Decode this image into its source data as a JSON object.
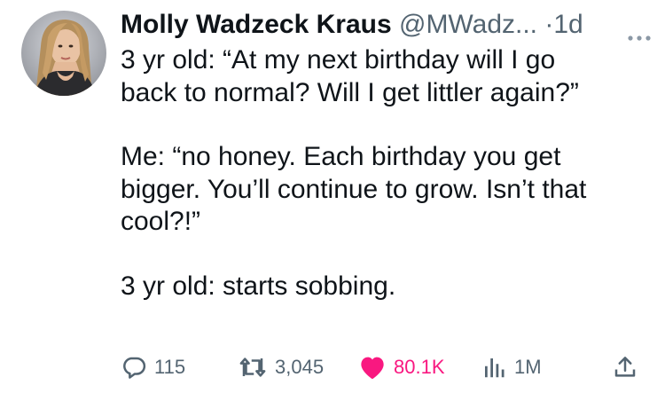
{
  "tweet": {
    "author_name": "Molly Wadzeck Kraus",
    "author_handle": "@MWadz...",
    "separator": "·",
    "timestamp": "1d",
    "lines": [
      "3 yr old: “At my next birthday will I go",
      "back to normal? Will I get littler again?”",
      "",
      "Me: “no honey. Each birthday you get",
      "bigger. You’ll continue to grow. Isn’t that",
      "cool?!”",
      "",
      "3 yr old: starts sobbing."
    ]
  },
  "actions": {
    "replies": "115",
    "retweets": "3,045",
    "likes": "80.1K",
    "views": "1M"
  },
  "icons": {
    "reply": "speech-bubble-icon",
    "retweet": "retweet-arrows-icon",
    "like": "heart-icon",
    "views": "bar-chart-icon",
    "share": "share-upload-icon",
    "more": "more-dots-icon"
  },
  "colors": {
    "text": "#0f1419",
    "secondary": "#536471",
    "like": "#f91880"
  }
}
